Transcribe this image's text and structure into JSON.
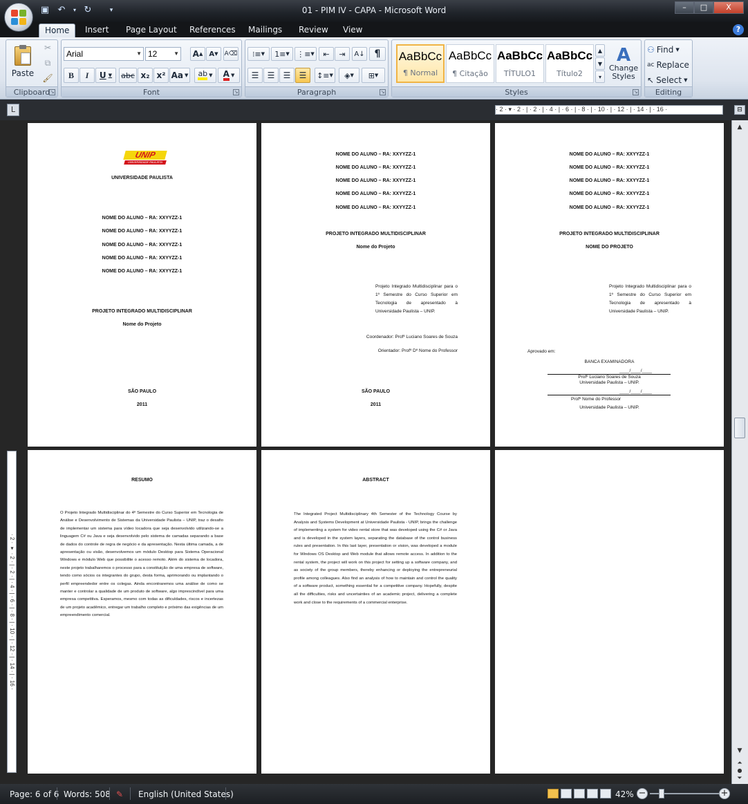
{
  "window": {
    "title": "01 - PIM IV - CAPA  -  Microsoft Word",
    "minimize": "–",
    "maximize": "□",
    "close": "X"
  },
  "tabs": [
    "Home",
    "Insert",
    "Page Layout",
    "References",
    "Mailings",
    "Review",
    "View"
  ],
  "help": "?",
  "ribbon": {
    "clipboard": {
      "label": "Clipboard",
      "paste": "Paste"
    },
    "font": {
      "label": "Font",
      "family": "Arial",
      "size": "12",
      "grow": "A",
      "shrink": "A",
      "bold": "B",
      "italic": "I",
      "underline": "U",
      "strike": "abc",
      "subscript": "x₂",
      "superscript": "x²",
      "change_case": "Aa",
      "font_color": "A"
    },
    "paragraph": {
      "label": "Paragraph",
      "pilcrow": "¶"
    },
    "styles": {
      "label": "Styles",
      "tiles": [
        {
          "sample": "AaBbCc",
          "name": "¶ Normal"
        },
        {
          "sample": "AaBbCc",
          "name": "¶ Citação"
        },
        {
          "sample": "AaBbCc",
          "name": "TÍTULO1"
        },
        {
          "sample": "AaBbCc",
          "name": "Título2"
        }
      ],
      "change_styles": "Change Styles"
    },
    "editing": {
      "label": "Editing",
      "find": "Find",
      "replace": "Replace",
      "select": "Select"
    }
  },
  "ruler": {
    "corner": "L",
    "ticks": "· 2 · ▾ · 2 · | · 2 · | · 4 · | · 6 · | · 8 · | · 10 · | · 12 · | · 14 · | · 16 ·"
  },
  "student_line": "NOME DO ALUNO – RA: XXYYZZ-1",
  "pages": {
    "p1": {
      "logo": "UNIP",
      "logo_sub": "UNIVERSIDADE PAULISTA",
      "university": "UNIVERSIDADE PAULISTA",
      "project": "PROJETO INTEGRADO MULTIDISCIPLINAR",
      "project_name": "Nome do Projeto",
      "city": "SÃO PAULO",
      "year": "2011"
    },
    "p2": {
      "project": "PROJETO INTEGRADO MULTIDISCIPLINAR",
      "project_name": "Nome do Projeto",
      "description": "Projeto Integrado Multidisciplinar para o 1º Semestre do Curso Superior em Tecnologia de apresentado à Universidade Paulista – UNIP.",
      "coordinator": "Coordenador: Profº Luciano Soares de Souza",
      "advisor": "Orientador: Profº Dº Nome do Professor",
      "city": "SÃO PAULO",
      "year": "2011"
    },
    "p3": {
      "project": "PROJETO INTEGRADO MULTIDISCIPLINAR",
      "project_name": "NOME DO PROJETO",
      "description": "Projeto Integrado Multidisciplinar para o 1º Semestre do Curso Superior em Tecnologia de apresentado à Universidade Paulista – UNIP.",
      "approved": "Aprovado em:",
      "board": "BANCA EXAMINADORA",
      "date_blank": "____/____/____",
      "member1_name": "Profº Luciano Soares de Souza",
      "member1_inst": "Universidade Paulista – UNIP.",
      "member2_name": "Profº Nome do Professor",
      "member2_inst": "Universidade Paulista – UNIP."
    },
    "p4": {
      "heading": "RESUMO",
      "body": "O Projeto Integrado Multidisciplinar do 4º Semestre do Curso Superior em Tecnologia de Análise e Desenvolvimento de Sistemas da Universidade Paulista – UNIP, traz o desafio de implementar um sistema para vídeo locadora que seja desenvolvido utilizando-se a linguagem C# ou Java e seja desenvolvido pelo sistema de camadas separando a base de dados do controle de regra de negócio e da apresentação. Nesta última camada, a de apresentação ou visão, desenvolvemos um módulo Desktop para Sistema Operacional Windows e módulo Web que possibilite o acesso remoto. Além do sistema de locadora, neste projeto trabalharemos o processo para a constituição de uma empresa de software, tendo como sócios os integrantes do grupo, desta forma, aprimorando ou implantando o perfil empreendedor entre os colegas. Ainda encontraremos uma análise de como se manter e controlar a qualidade de um produto de software, algo imprescindível para uma empresa competitiva. Esperamos, mesmo com todas as dificuldades, riscos e incertezas de um projeto acadêmico, entregar um trabalho completo e próximo das exigências de um empreendimento comercial."
    },
    "p5": {
      "heading": "ABSTRACT",
      "body": "The Integrated Project Multidisciplinary 4th Semester of the Technology Course by Analysis and Systems Development at Universidade Paulista - UNIP, brings the challenge of implementing a system for video rental store that was developed using the C# or Java and is developed in the system layers, separating the database of the control business rules and presentation. In this last layer, presentation or vision, was developed a module for Windows OS Desktop and Web module that allows remote access. In addition to the rental system, the project will work on this project for setting up a software company, and as society of the group members, thereby enhancing or deploying the entrepreneurial profile among colleagues. Also find an analysis of how to maintain and control the quality of a software product, something essential for a competitive company. Hopefully, despite all the difficulties, risks and uncertainties of an academic project, delivering a complete work and close to the requirements of a commercial enterprise."
    }
  },
  "status": {
    "page": "Page: 6 of 6",
    "words": "Words: 508",
    "language": "English (United States)",
    "zoom": "42%",
    "zoom_out": "−",
    "zoom_in": "+"
  }
}
